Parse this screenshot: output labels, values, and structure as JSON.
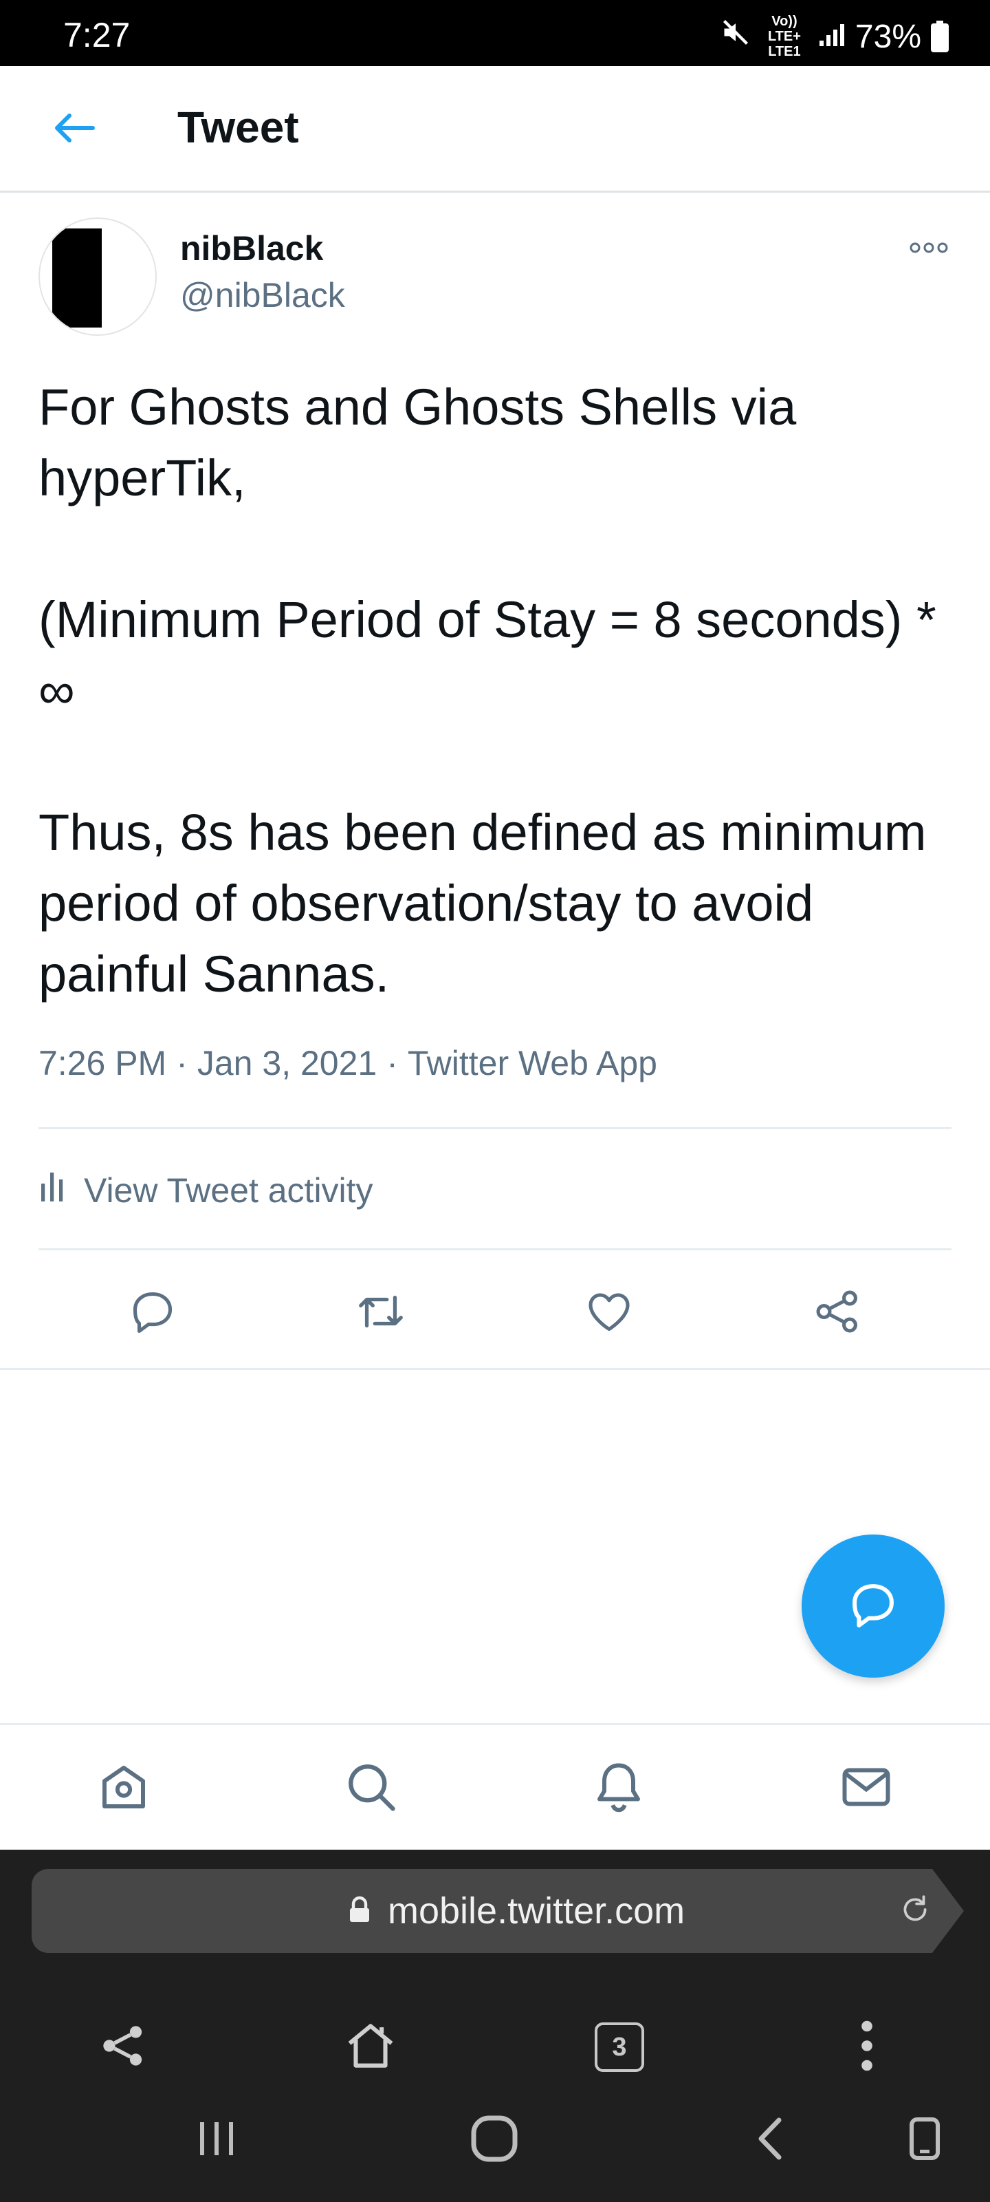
{
  "status_bar": {
    "time": "7:27",
    "network": "Vo)) LTE+ LTE1",
    "battery": "73%"
  },
  "header": {
    "title": "Tweet"
  },
  "tweet": {
    "author_name": "nibBlack",
    "author_handle": "@nibBlack",
    "text": "For Ghosts and Ghosts Shells via hyperTik,\n\n(Minimum Period of Stay = 8 seconds) * ∞\n\nThus, 8s has been defined as minimum period of observation/stay to avoid painful Sannas.",
    "time": "7:26 PM",
    "date": "Jan 3, 2021",
    "source": "Twitter Web App",
    "separator": "·",
    "activity_label": "View Tweet activity"
  },
  "browser": {
    "url": "mobile.twitter.com",
    "tab_count": "3"
  },
  "colors": {
    "accent": "#1da1f2",
    "secondary_text": "#5b7083",
    "icon_gray": "#5b7083"
  }
}
